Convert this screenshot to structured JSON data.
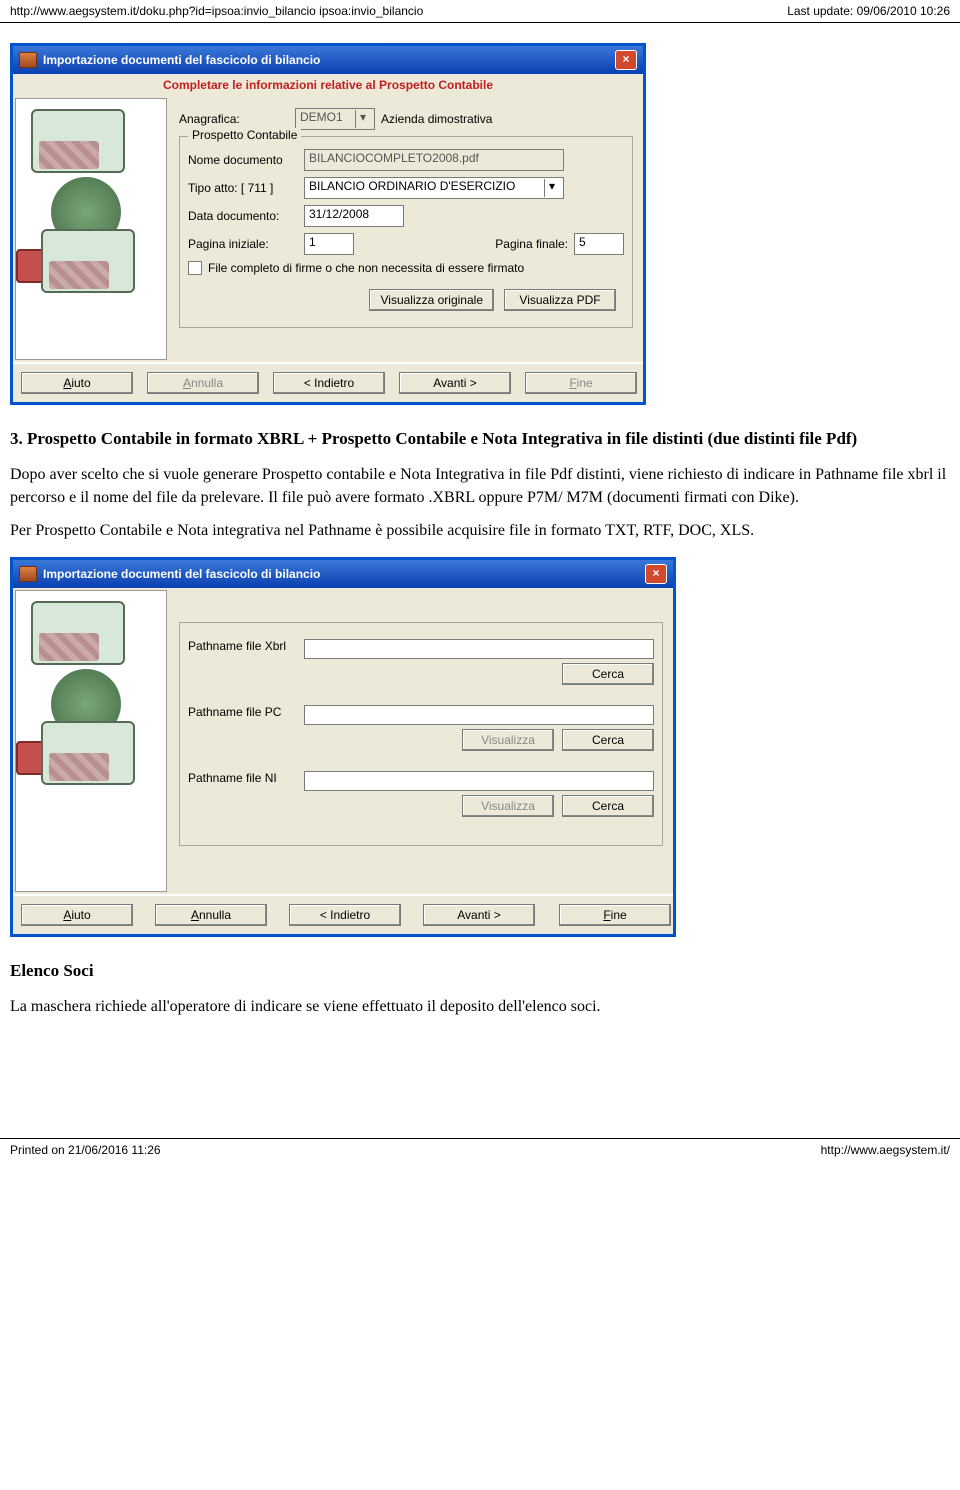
{
  "header": {
    "left": "http://www.aegsystem.it/doku.php?id=ipsoa:invio_bilancio   ipsoa:invio_bilancio",
    "right": "Last update: 09/06/2010 10:26"
  },
  "footer": {
    "left": "Printed on 21/06/2016 11:26",
    "right": "http://www.aegsystem.it/"
  },
  "dialog1": {
    "title": "Importazione documenti del fascicolo di bilancio",
    "subtitle": "Completare le informazioni relative al Prospetto Contabile",
    "anagrafica_label": "Anagrafica:",
    "anagrafica_value": "DEMO1",
    "anagrafica_desc": "Azienda dimostrativa",
    "group1_legend": "Prospetto Contabile",
    "nome_doc_label": "Nome documento",
    "nome_doc_value": "BILANCIOCOMPLETO2008.pdf",
    "tipo_atto_label": "Tipo atto:   [ 711 ]",
    "tipo_atto_value": "BILANCIO ORDINARIO D'ESERCIZIO",
    "data_doc_label": "Data documento:",
    "data_doc_value": "31/12/2008",
    "pag_ini_label": "Pagina iniziale:",
    "pag_ini_value": "1",
    "pag_fin_label": "Pagina finale:",
    "pag_fin_value": "5",
    "chk_label": "File completo di firme o che non necessita di essere firmato",
    "btn_vis_orig": "Visualizza originale",
    "btn_vis_pdf": "Visualizza PDF",
    "nav_aiuto": "Aiuto",
    "nav_annulla": "Annulla",
    "nav_indietro": "< Indietro",
    "nav_avanti": "Avanti >",
    "nav_fine": "Fine"
  },
  "prose": {
    "h1": "3. Prospetto Contabile in formato XBRL + Prospetto Contabile e Nota Integrativa in file distinti (due distinti file Pdf)",
    "p1": "Dopo aver scelto che si vuole generare Prospetto contabile e Nota Integrativa in file Pdf distinti, viene richiesto di indicare in Pathname file xbrl il percorso e il nome del file da prelevare. Il file può avere formato .XBRL oppure P7M/ M7M (documenti firmati con Dike).",
    "p2": "Per Prospetto Contabile e Nota integrativa nel Pathname è possibile acquisire file in formato TXT, RTF, DOC, XLS.",
    "h2": "Elenco Soci",
    "p3": "La maschera richiede all'operatore di indicare se viene effettuato il deposito dell'elenco soci."
  },
  "dialog2": {
    "title": "Importazione documenti del fascicolo di bilancio",
    "xbrl_label": "Pathname file Xbrl",
    "pc_label": "Pathname file PC",
    "ni_label": "Pathname file NI",
    "btn_cerca": "Cerca",
    "btn_visualizza": "Visualizza",
    "nav_aiuto": "Aiuto",
    "nav_annulla": "Annulla",
    "nav_indietro": "< Indietro",
    "nav_avanti": "Avanti >",
    "nav_fine": "Fine"
  }
}
